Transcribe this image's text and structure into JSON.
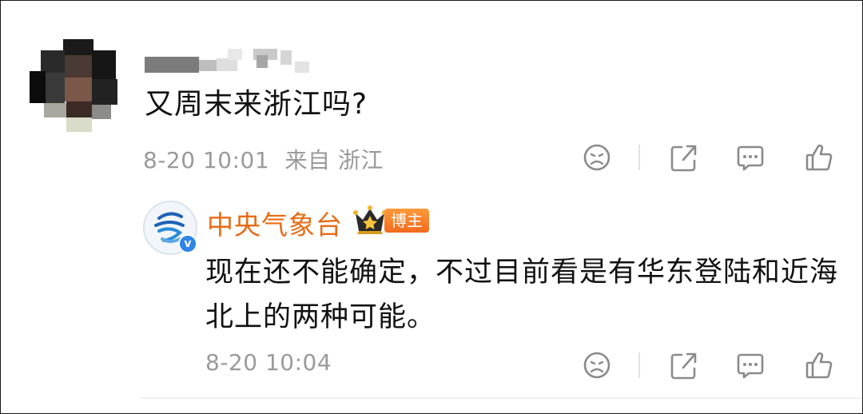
{
  "comment": {
    "text": "又周末来浙江吗?",
    "time": "8-20 10:01",
    "location": "来自 浙江"
  },
  "reply": {
    "author": "中央气象台",
    "author_tag": "博主",
    "text": "现在还不能确定，不过目前看是有华东登陆和近海北上的两种可能。",
    "time": "8-20 10:04"
  },
  "icons": {
    "dislike": "sad-face-icon",
    "share": "share-icon",
    "comment": "comment-icon",
    "like": "thumbs-up-icon",
    "crown": "crown-badge-icon",
    "verified": "verified-v-icon"
  },
  "colors": {
    "author_name": "#e86b14",
    "tag_bg": "#f26b1d",
    "meta_gray": "#9a9a9a",
    "icon_gray": "#8a8a8a",
    "verified_blue": "#2f86e8"
  }
}
